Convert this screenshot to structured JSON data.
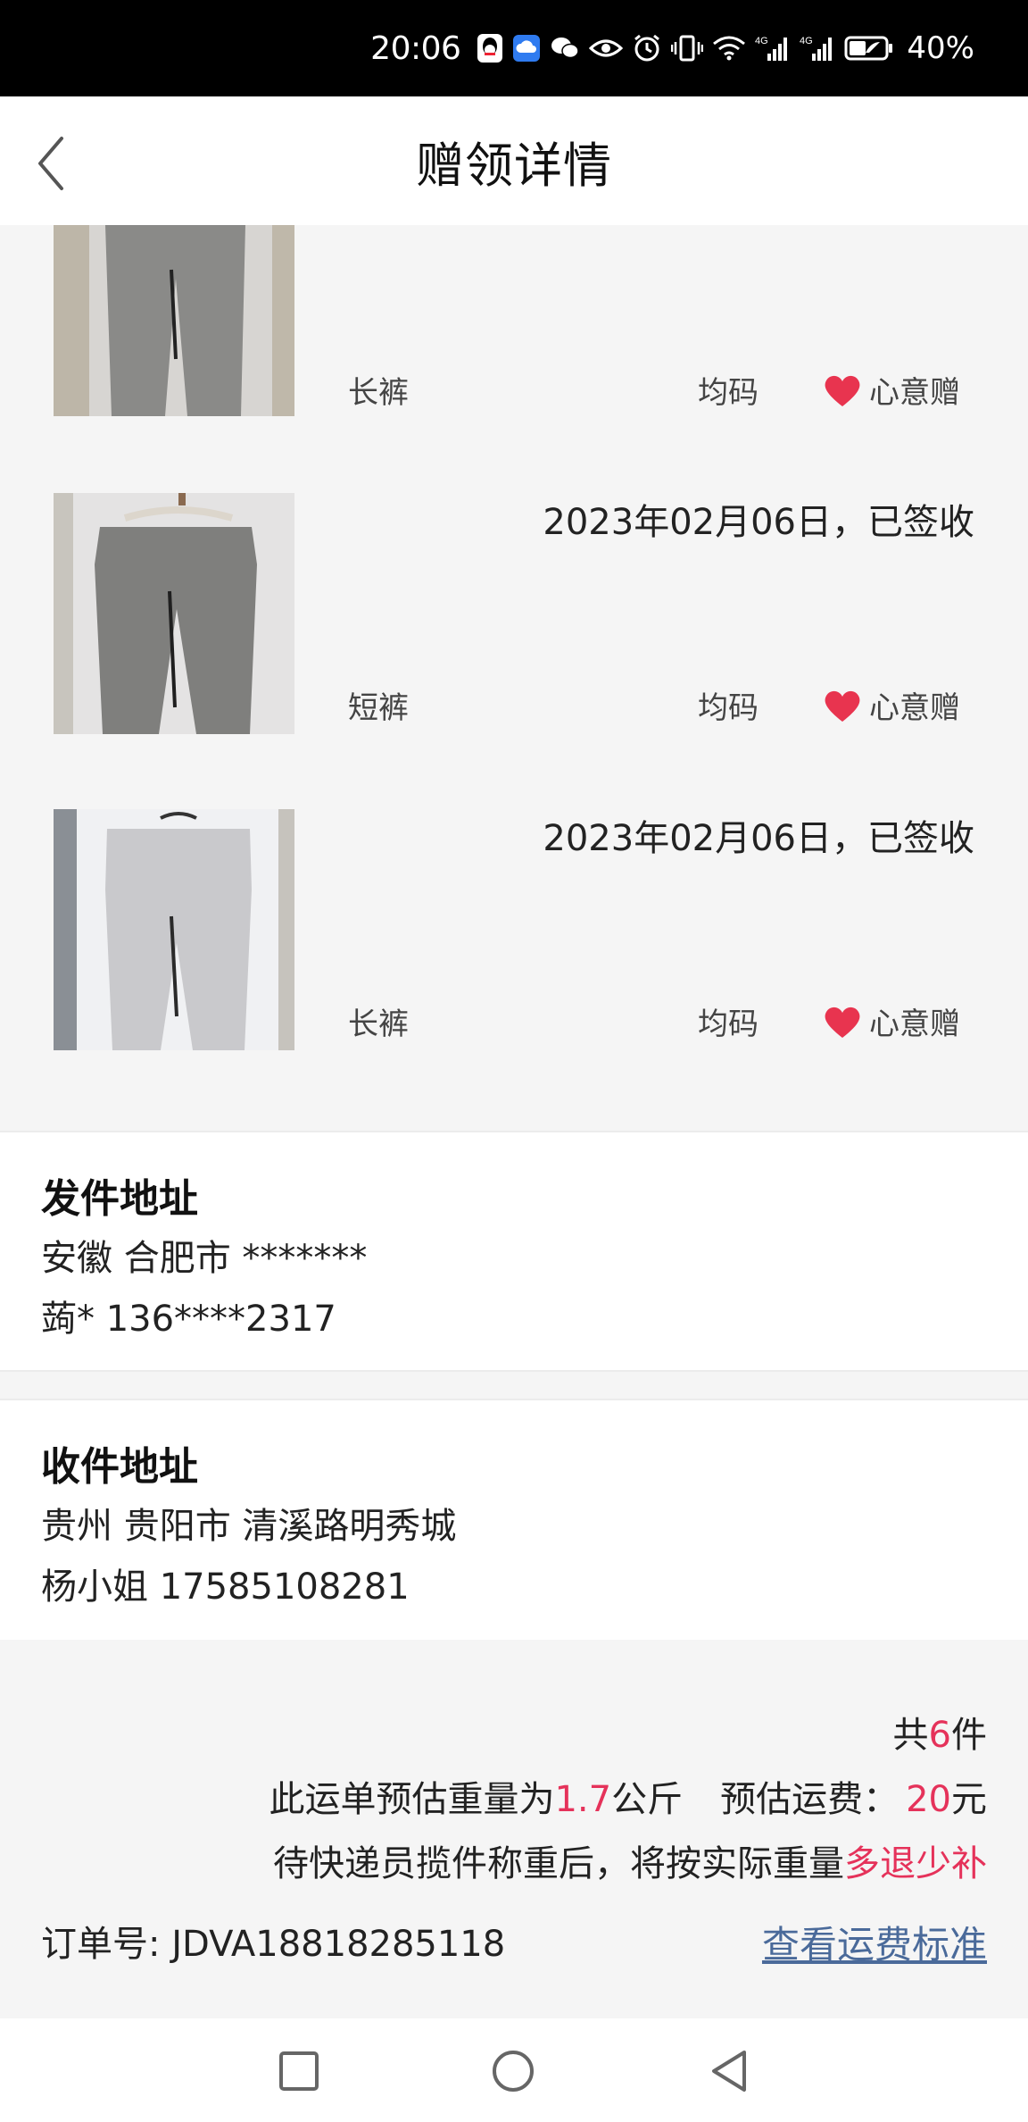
{
  "status_bar": {
    "time": "20:06",
    "battery": "40%",
    "icons": [
      "qq-icon",
      "cloud-icon",
      "wechat-icon",
      "eye-icon",
      "alarm-icon",
      "vibrate-icon",
      "wifi-icon",
      "signal-4g-icon",
      "signal-4g-icon",
      "battery-icon"
    ]
  },
  "header": {
    "title": "赠领详情",
    "back_icon": "chevron-left-icon"
  },
  "items": [
    {
      "date": "",
      "type": "长裤",
      "size": "均码",
      "gift_label": "心意赠",
      "photo_color": "#8a8a88"
    },
    {
      "date": "2023年02月06日，已签收",
      "type": "短裤",
      "size": "均码",
      "gift_label": "心意赠",
      "photo_color": "#7f7f7d"
    },
    {
      "date": "2023年02月06日，已签收",
      "type": "长裤",
      "size": "均码",
      "gift_label": "心意赠",
      "photo_color": "#c9c9cc"
    }
  ],
  "sender": {
    "title": "发件地址",
    "address": "安徽 合肥市 *******",
    "contact": "蒟* 136****2317"
  },
  "receiver": {
    "title": "收件地址",
    "address": "贵州 贵阳市 清溪路明秀城",
    "contact": "杨小姐 17585108281"
  },
  "summary": {
    "count_prefix": "共",
    "count": "6",
    "count_suffix": "件",
    "weight_prefix": "此运单预估重量为",
    "weight": "1.7",
    "weight_unit": "公斤",
    "fee_prefix": "预估运费：",
    "fee": "20",
    "fee_unit": "元",
    "note_prefix": "待快递员揽件称重后，将按实际重量",
    "note_accent": "多退少补",
    "order_label": "订单号:",
    "order_number": "JDVA18818285118",
    "fee_standard_link": "查看运费标准"
  },
  "colors": {
    "accent": "#e5325a",
    "heart": "#e8344f",
    "link": "#4a6a9a"
  },
  "nav": {
    "icons": [
      "square-recent-icon",
      "circle-home-icon",
      "triangle-back-icon"
    ]
  }
}
